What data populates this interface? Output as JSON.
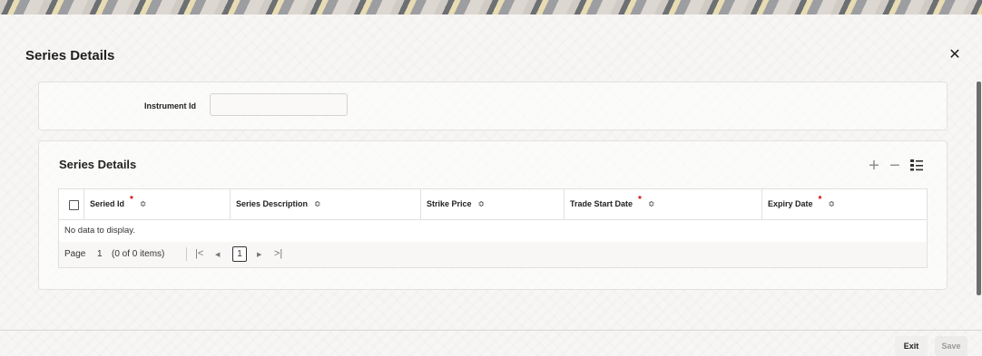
{
  "dialog": {
    "title": "Series Details",
    "close_icon": "close-icon"
  },
  "instrument": {
    "label": "Instrument Id",
    "value": "",
    "placeholder": ""
  },
  "series_section": {
    "title": "Series Details",
    "toolbar": {
      "add_icon": "plus-icon",
      "remove_icon": "minus-icon",
      "view_icon": "list-view-icon"
    },
    "columns": [
      {
        "label": "Seried Id",
        "required": true
      },
      {
        "label": "Series Description",
        "required": false
      },
      {
        "label": "Strike Price",
        "required": false
      },
      {
        "label": "Trade Start Date",
        "required": true
      },
      {
        "label": "Expiry Date",
        "required": true
      }
    ],
    "required_marker": "*",
    "sort_glyph": "≎",
    "empty_text": "No data to display.",
    "pager": {
      "page_label": "Page",
      "page_field": "1",
      "count_text": "(0 of 0 items)",
      "current_page": "1",
      "first": "|<",
      "prev": "◀",
      "next": "▶",
      "last": ">|"
    }
  },
  "footer": {
    "exit_label": "Exit",
    "save_label": "Save"
  },
  "colors": {
    "required": "#d40000",
    "save_disabled_text": "#9a9a9a"
  }
}
